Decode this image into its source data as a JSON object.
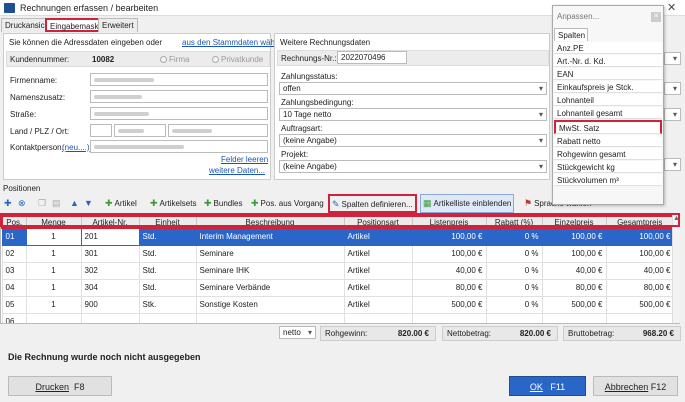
{
  "window": {
    "title": "Rechnungen erfassen / bearbeiten",
    "minimize": "—",
    "close": "✕"
  },
  "tabs": [
    {
      "label": "Druckansicht"
    },
    {
      "label": "Eingabemaske"
    },
    {
      "label": "Erweitert"
    }
  ],
  "address": {
    "hint": "Sie können die Adressdaten eingeben oder",
    "hint_link": "aus den Stammdaten wählen...",
    "kundennummer_label": "Kundennummer:",
    "kundennummer": "10082",
    "radio_firma": "Firma",
    "radio_privat": "Privatkunde",
    "firmenname_label": "Firmenname:",
    "namenszusatz_label": "Namenszusatz:",
    "strasse_label": "Straße:",
    "land_label": "Land / PLZ / Ort:",
    "kontakt_label": "Kontaktperson:",
    "kontakt_link": "(neu....)",
    "felder_link": "Felder leeren",
    "weitere_link": "weitere Daten..."
  },
  "invoice": {
    "title": "Weitere Rechnungsdaten",
    "nr_label": "Rechnungs-Nr.:",
    "nr": "2022070496",
    "status_label": "Zahlungsstatus:",
    "status": "offen",
    "bedingung_label": "Zahlungsbedingung:",
    "bedingung": "10 Tage netto",
    "auftragsart_label": "Auftragsart:",
    "auftragsart": "(keine Angabe)",
    "projekt_label": "Projekt:",
    "projekt": "(keine Angabe)"
  },
  "positionen_label": "Positionen",
  "toolbar": {
    "artikel": "Artikel",
    "artikelsets": "Artikelsets",
    "bundles": "Bundles",
    "pos_vorgang": "Pos. aus Vorgang",
    "spalten": "Spalten definieren...",
    "artikelliste": "Artikelliste einblenden",
    "sprache": "Sprache wählen"
  },
  "columns": [
    "Pos.",
    "Menge",
    "Artikel-Nr.",
    "Einheit",
    "Beschreibung",
    "Positionsart",
    "Listenpreis",
    "Rabatt (%)",
    "Einzelpreis",
    "Gesamtpreis"
  ],
  "rows": [
    [
      "01",
      "1",
      "201",
      "Std.",
      "Interim Management",
      "Artikel",
      "100,00 €",
      "0 %",
      "100,00 €",
      "100,00 €"
    ],
    [
      "02",
      "1",
      "301",
      "Std.",
      "Seminare",
      "Artikel",
      "100,00 €",
      "0 %",
      "100,00 €",
      "100,00 €"
    ],
    [
      "03",
      "1",
      "302",
      "Std.",
      "Seminare IHK",
      "Artikel",
      "40,00 €",
      "0 %",
      "40,00 €",
      "40,00 €"
    ],
    [
      "04",
      "1",
      "304",
      "Std.",
      "Seminare Verbände",
      "Artikel",
      "80,00 €",
      "0 %",
      "80,00 €",
      "80,00 €"
    ],
    [
      "05",
      "1",
      "900",
      "Stk.",
      "Sonstige Kosten",
      "Artikel",
      "500,00 €",
      "0 %",
      "500,00 €",
      "500,00 €"
    ],
    [
      "06",
      "",
      "",
      "",
      "",
      "",
      "",
      "",
      "",
      ""
    ]
  ],
  "totals": {
    "mode": "netto",
    "rohgewinn_label": "Rohgewinn:",
    "rohgewinn": "820.00 €",
    "netto_label": "Nettobetrag:",
    "netto": "820.00 €",
    "brutto_label": "Bruttobetrag:",
    "brutto": "968.20 €"
  },
  "status_msg": "Die Rechnung wurde noch nicht ausgegeben",
  "buttons": {
    "drucken": "Drucken",
    "drucken_key": "F8",
    "ok": "OK",
    "ok_key": "F11",
    "abbrechen": "Abbrechen",
    "abbrechen_key": "F12"
  },
  "popup": {
    "title": "Anpassen...",
    "tab": "Spalten",
    "items": [
      "Anz.PE",
      "Art.-Nr. d. Kd.",
      "EAN",
      "Einkaufspreis je Stck.",
      "Lohnanteil",
      "Lohnanteil gesamt",
      "MwSt. Satz",
      "Rabatt netto",
      "Rohgewinn gesamt",
      "Stückgewicht kg",
      "Stückvolumen m³"
    ]
  }
}
